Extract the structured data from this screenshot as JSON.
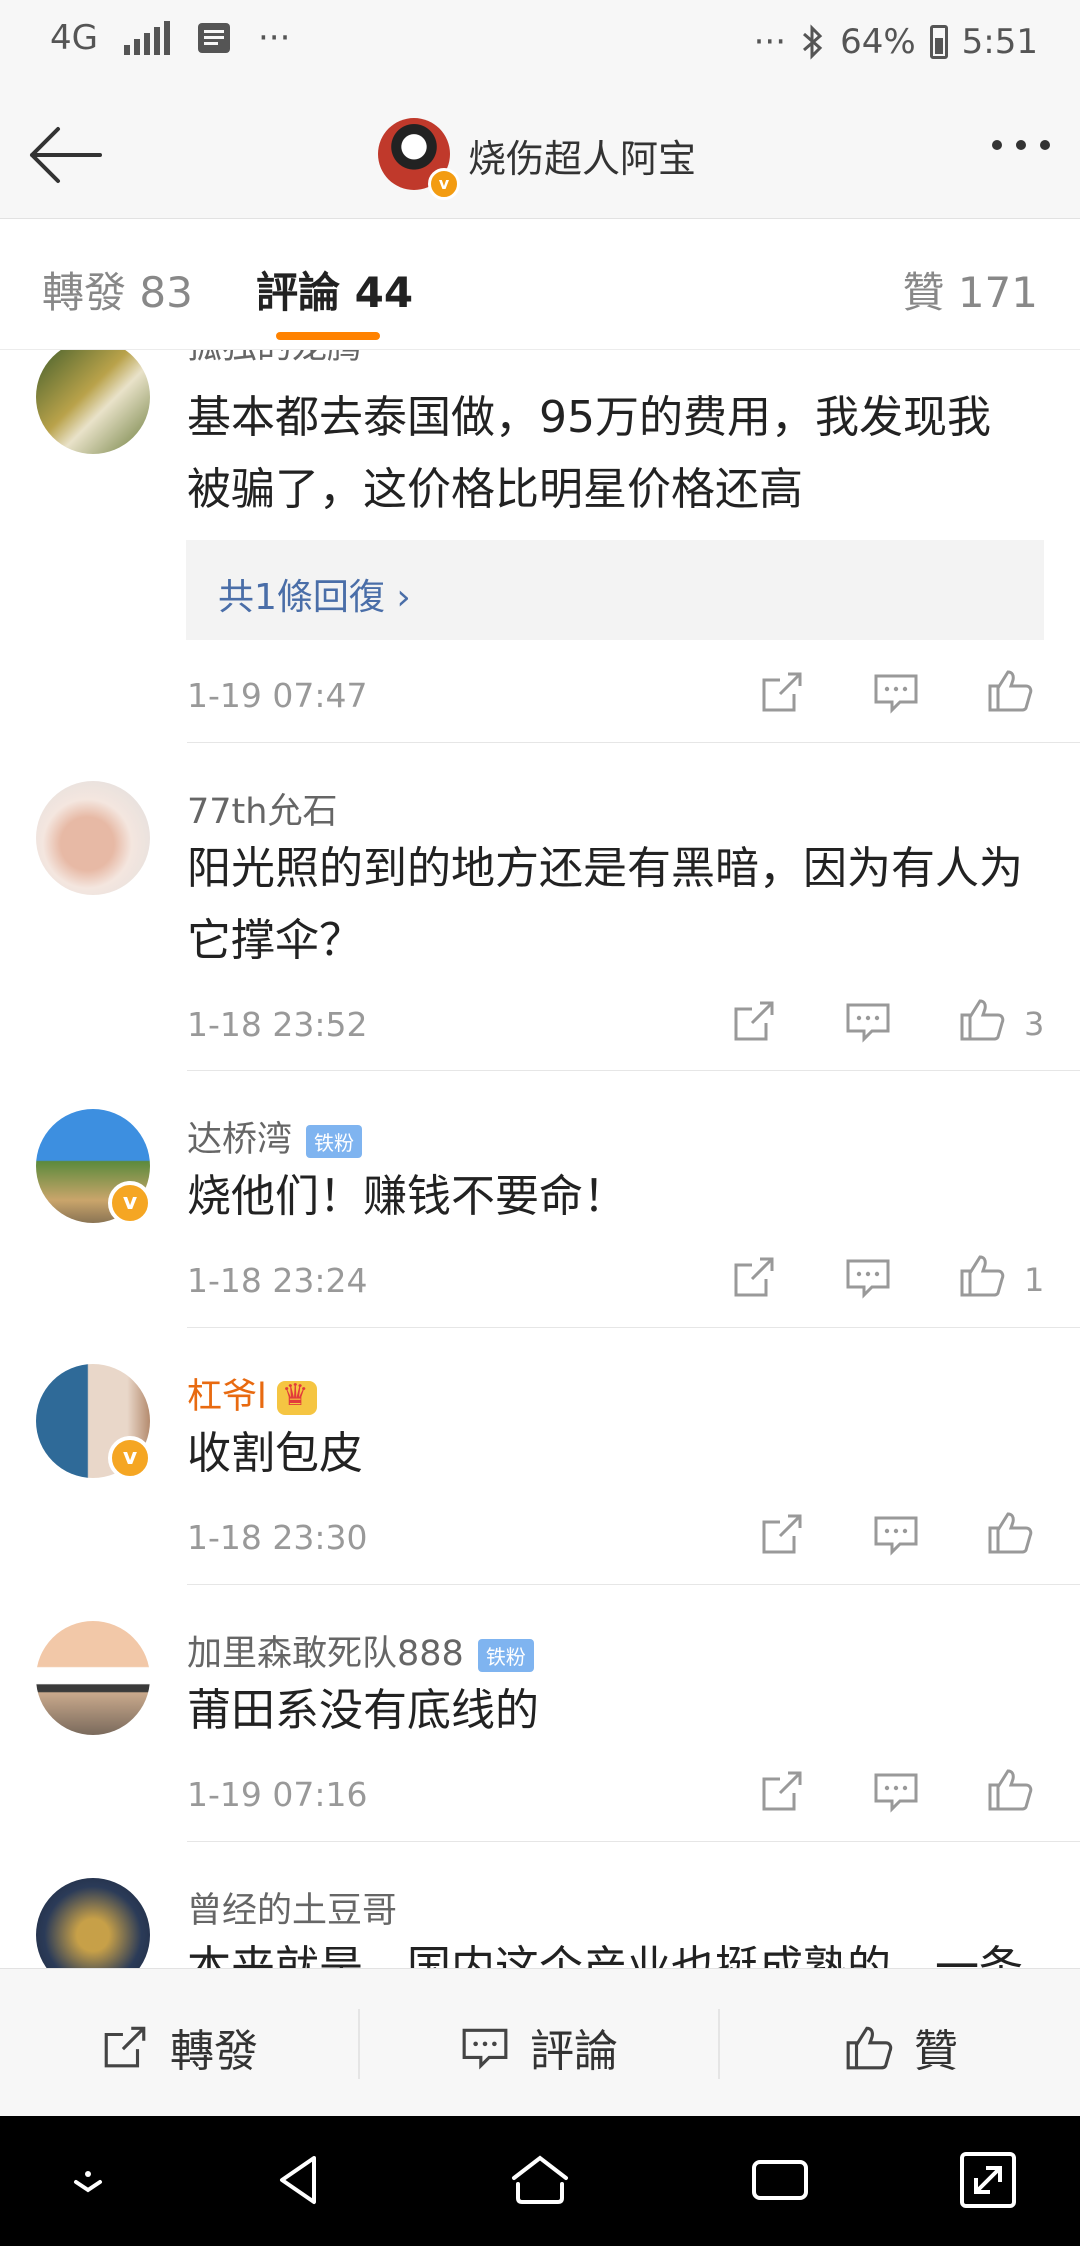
{
  "status_bar": {
    "network": "4G",
    "battery": "64%",
    "time": "5:51",
    "left_more": "···",
    "right_more": "···"
  },
  "header": {
    "title": "烧伤超人阿宝"
  },
  "tabs": {
    "repost": "轉發 83",
    "comments": "評論 44",
    "likes": "贊 171"
  },
  "comments": [
    {
      "username": "孤独的龙腾",
      "text_line1": "基本都去泰国做，95万的费用，我发现我",
      "text_line2": "被骗了，这价格比明星价格还高",
      "reply_link": "共1條回復 ›",
      "time": "1-19 07:47",
      "likes": ""
    },
    {
      "username": "77th允石",
      "text_line1": "阳光照的到的地方还是有黑暗，因为有人为",
      "text_line2": "它撑伞？",
      "time": "1-18 23:52",
      "likes": "3"
    },
    {
      "username": "达桥湾",
      "tag": "铁粉",
      "text_line1": "烧他们！赚钱不要命！",
      "time": "1-18 23:24",
      "likes": "1"
    },
    {
      "username": "杠爷l",
      "text_line1": "收割包皮",
      "time": "1-18 23:30",
      "likes": ""
    },
    {
      "username": "加里森敢死队888",
      "tag": "铁粉",
      "text_line1": "莆田系没有底线的",
      "time": "1-19 07:16",
      "likes": ""
    },
    {
      "username": "曾经的土豆哥",
      "text_line1": "本来就是，国内这个产业也挺成熟的，一条"
    }
  ],
  "bottom_bar": {
    "repost": "轉發",
    "comment": "評論",
    "like": "贊"
  }
}
